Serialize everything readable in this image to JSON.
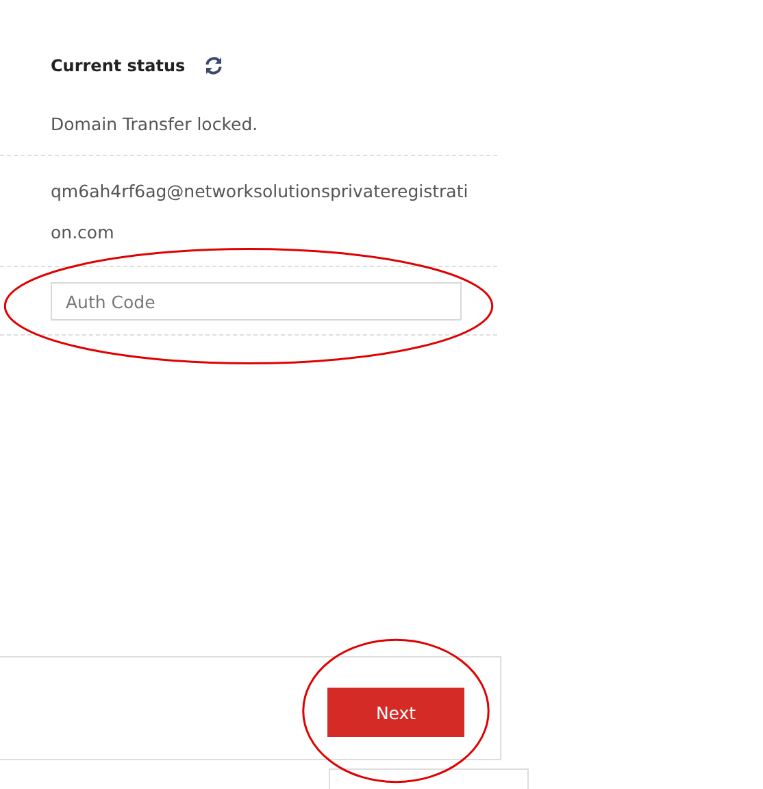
{
  "status": {
    "title": "Current status",
    "message": "Domain Transfer locked."
  },
  "email": "qm6ah4rf6ag@networksolutionsprivateregistration.com",
  "auth_field": {
    "placeholder": "Auth Code"
  },
  "footer": {
    "button": "Next"
  },
  "annotations": [
    {
      "kind": "ellipse"
    },
    {
      "kind": "ellipse"
    }
  ]
}
